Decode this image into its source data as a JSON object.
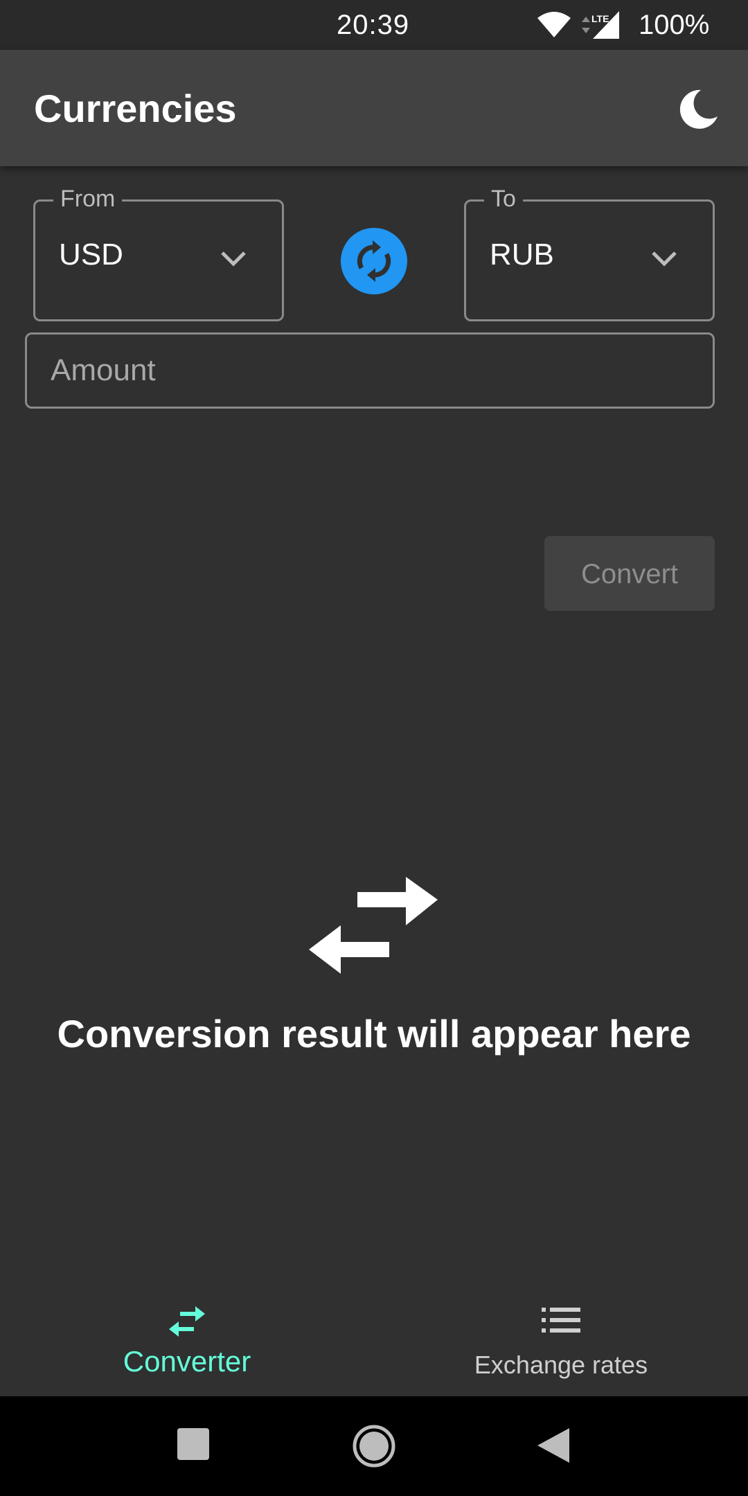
{
  "status_bar": {
    "time": "20:39",
    "network": "LTE",
    "battery": "100%",
    "icons": [
      "wifi-icon",
      "lte-signal-icon"
    ]
  },
  "app_bar": {
    "title": "Currencies",
    "theme_icon": "moon-icon"
  },
  "converter": {
    "from_label": "From",
    "from_value": "USD",
    "to_label": "To",
    "to_value": "RUB",
    "swap_icon": "sync-icon",
    "amount_placeholder": "Amount",
    "amount_value": "",
    "convert_label": "Convert",
    "result_icon": "swap-horiz-icon",
    "result_text": "Conversion result will appear here"
  },
  "bottom_nav": {
    "items": [
      {
        "label": "Converter",
        "icon": "swap-horiz-icon",
        "active": true
      },
      {
        "label": "Exchange rates",
        "icon": "list-icon",
        "active": false
      }
    ]
  },
  "system_nav": {
    "icons": [
      "recents-icon",
      "home-icon",
      "back-icon"
    ]
  },
  "colors": {
    "background": "#303030",
    "app_bar": "#424242",
    "accent_blue": "#2196f3",
    "active_nav": "#64ffda"
  }
}
